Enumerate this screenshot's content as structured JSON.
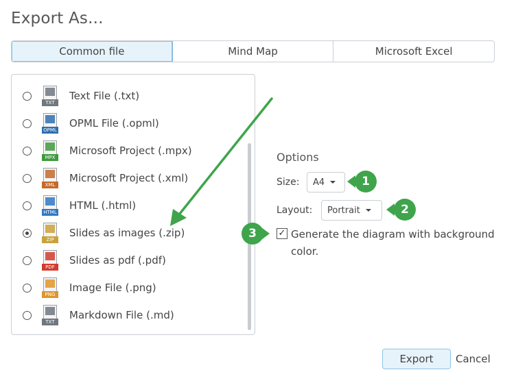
{
  "dialog": {
    "title": "Export As..."
  },
  "tabs": [
    {
      "label": "Common file",
      "active": true
    },
    {
      "label": "Mind Map",
      "active": false
    },
    {
      "label": "Microsoft Excel",
      "active": false
    }
  ],
  "formats": [
    {
      "label": "Text File (.txt)",
      "tag": "TXT",
      "icon": "text-file-icon",
      "color": "#6f7780",
      "checked": false
    },
    {
      "label": "OPML File (.opml)",
      "tag": "OPML",
      "icon": "opml-file-icon",
      "color": "#2f6fb0",
      "checked": false
    },
    {
      "label": "Microsoft Project (.mpx)",
      "tag": "MPX",
      "icon": "mpx-file-icon",
      "color": "#3f9a3f",
      "checked": false
    },
    {
      "label": "Microsoft Project (.xml)",
      "tag": "XML",
      "icon": "xml-file-icon",
      "color": "#c46a2a",
      "checked": false
    },
    {
      "label": "HTML (.html)",
      "tag": "HTML",
      "icon": "html-file-icon",
      "color": "#2f78c4",
      "checked": false
    },
    {
      "label": "Slides as images (.zip)",
      "tag": "ZIP",
      "icon": "zip-file-icon",
      "color": "#c9a23a",
      "checked": true
    },
    {
      "label": "Slides as pdf (.pdf)",
      "tag": "PDF",
      "icon": "pdf-file-icon",
      "color": "#d23b2e",
      "checked": false
    },
    {
      "label": "Image File (.png)",
      "tag": "PNG",
      "icon": "png-file-icon",
      "color": "#e0952a",
      "checked": false
    },
    {
      "label": "Markdown File (.md)",
      "tag": "TXT",
      "icon": "markdown-file-icon",
      "color": "#6f7780",
      "checked": false
    }
  ],
  "options": {
    "title": "Options",
    "size_label": "Size:",
    "size_value": "A4",
    "layout_label": "Layout:",
    "layout_value": "Portrait",
    "checkbox_checked": true,
    "checkbox_mark": "✓",
    "checkbox_label": "Generate the diagram with background color."
  },
  "callouts": [
    "1",
    "2",
    "3"
  ],
  "buttons": {
    "export": "Export",
    "cancel": "Cancel"
  },
  "colors": {
    "accent_green": "#3fa44b",
    "active_tab_bg": "#e7f3fb"
  }
}
